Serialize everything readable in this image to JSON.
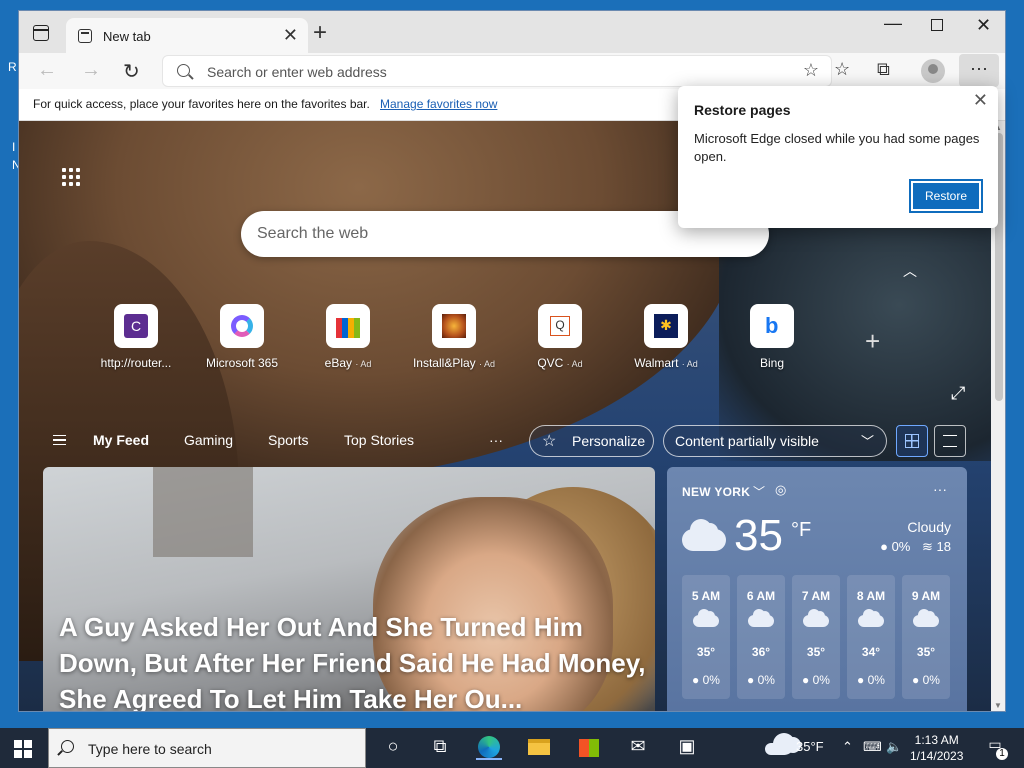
{
  "desktop": {
    "edge_letters": [
      "R",
      "I",
      "N"
    ]
  },
  "browser": {
    "tab_title": "New tab",
    "address_placeholder": "Search or enter web address",
    "favbar_text": "For quick access, place your favorites here on the favorites bar.",
    "favbar_link": "Manage favorites now"
  },
  "newtab": {
    "search_placeholder": "Search the web",
    "quick_links": [
      {
        "label": "http://router...",
        "ad": "",
        "icon": "c-icon",
        "color": "#5c2d91"
      },
      {
        "label": "Microsoft 365",
        "ad": "",
        "icon": "m365-icon",
        "color": "#7b5cff"
      },
      {
        "label": "eBay",
        "ad": "· Ad",
        "icon": "ebay-bag-icon",
        "color": "#e53238"
      },
      {
        "label": "Install&Play",
        "ad": "· Ad",
        "icon": "game-icon",
        "color": "#b4501c"
      },
      {
        "label": "QVC",
        "ad": "· Ad",
        "icon": "qvc-icon",
        "color": "#d9531e"
      },
      {
        "label": "Walmart",
        "ad": "· Ad",
        "icon": "walmart-icon",
        "color": "#0b1d5a"
      },
      {
        "label": "Bing",
        "ad": "",
        "icon": "bing-icon",
        "color": "#1877f2"
      }
    ],
    "feed_tabs": [
      "My Feed",
      "Gaming",
      "Sports",
      "Top Stories"
    ],
    "more": "···",
    "personalize": "Personalize",
    "content_visibility": "Content partially visible",
    "headline": "A Guy Asked Her Out And She Turned Him Down, But After Her Friend Said He Had Money, She Agreed To Let Him Take Her Ou..."
  },
  "weather": {
    "city": "NEW YORK",
    "more": "···",
    "temp": "35",
    "unit": "°F",
    "condition": "Cloudy",
    "precip": "0%",
    "wind": "18",
    "hours": [
      {
        "time": "5 AM",
        "temp": "35°",
        "precip": "0%"
      },
      {
        "time": "6 AM",
        "temp": "36°",
        "precip": "0%"
      },
      {
        "time": "7 AM",
        "temp": "35°",
        "precip": "0%"
      },
      {
        "time": "8 AM",
        "temp": "34°",
        "precip": "0%"
      },
      {
        "time": "9 AM",
        "temp": "35°",
        "precip": "0%"
      }
    ]
  },
  "popup": {
    "title": "Restore pages",
    "message": "Microsoft Edge closed while you had some pages open.",
    "button": "Restore"
  },
  "taskbar": {
    "search_placeholder": "Type here to search",
    "temp": "35°F",
    "time": "1:13 AM",
    "date": "1/14/2023",
    "notifications": "1"
  }
}
